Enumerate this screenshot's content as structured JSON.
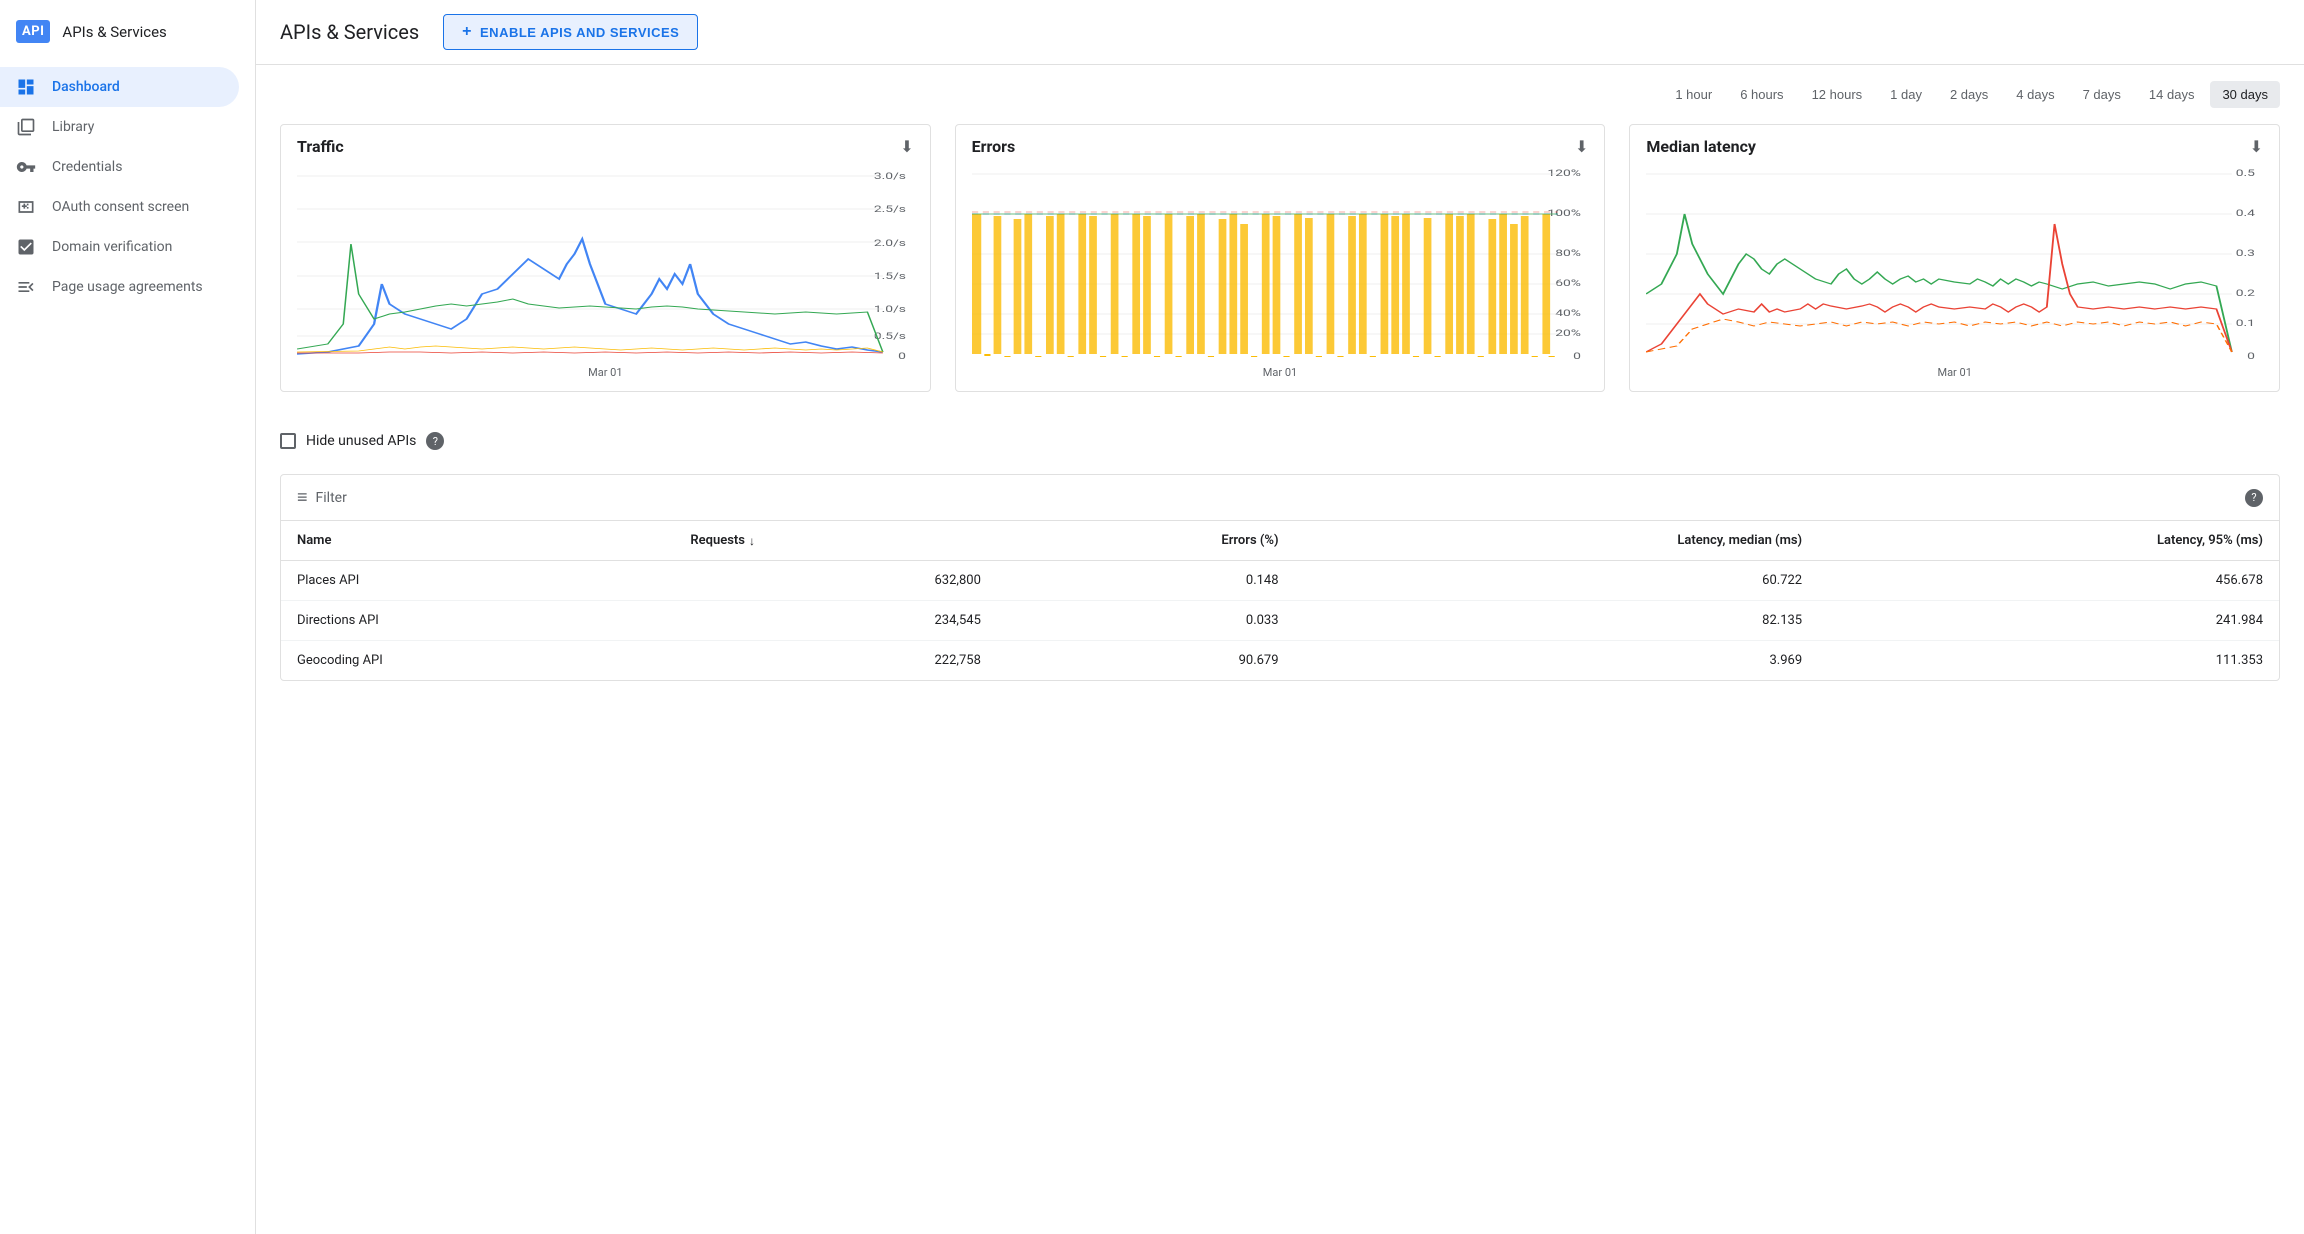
{
  "sidebar": {
    "logo_text": "API",
    "title": "APIs & Services",
    "items": [
      {
        "id": "dashboard",
        "label": "Dashboard",
        "icon": "◈",
        "active": true
      },
      {
        "id": "library",
        "label": "Library",
        "icon": "▦",
        "active": false
      },
      {
        "id": "credentials",
        "label": "Credentials",
        "icon": "⚿",
        "active": false
      },
      {
        "id": "oauth",
        "label": "OAuth consent screen",
        "icon": "⋮⋮",
        "active": false
      },
      {
        "id": "domain",
        "label": "Domain verification",
        "icon": "☑",
        "active": false
      },
      {
        "id": "page-usage",
        "label": "Page usage agreements",
        "icon": "≡☆",
        "active": false
      }
    ]
  },
  "header": {
    "title": "APIs & Services",
    "enable_button_label": "ENABLE APIS AND SERVICES"
  },
  "time_range": {
    "options": [
      "1 hour",
      "6 hours",
      "12 hours",
      "1 day",
      "2 days",
      "4 days",
      "7 days",
      "14 days",
      "30 days"
    ],
    "active": "30 days"
  },
  "charts": {
    "traffic": {
      "title": "Traffic",
      "x_label": "Mar 01"
    },
    "errors": {
      "title": "Errors",
      "x_label": "Mar 01"
    },
    "latency": {
      "title": "Median latency",
      "x_label": "Mar 01"
    }
  },
  "hide_unused": {
    "label": "Hide unused APIs",
    "checked": false
  },
  "table": {
    "filter_placeholder": "Filter",
    "columns": [
      {
        "key": "name",
        "label": "Name"
      },
      {
        "key": "requests",
        "label": "Requests",
        "sortable": true
      },
      {
        "key": "errors",
        "label": "Errors (%)"
      },
      {
        "key": "latency_median",
        "label": "Latency, median (ms)"
      },
      {
        "key": "latency_95",
        "label": "Latency, 95% (ms)"
      }
    ],
    "rows": [
      {
        "name": "Places API",
        "requests": "632,800",
        "errors": "0.148",
        "latency_median": "60.722",
        "latency_95": "456.678"
      },
      {
        "name": "Directions API",
        "requests": "234,545",
        "errors": "0.033",
        "latency_median": "82.135",
        "latency_95": "241.984"
      },
      {
        "name": "Geocoding API",
        "requests": "222,758",
        "errors": "90.679",
        "latency_median": "3.969",
        "latency_95": "111.353"
      }
    ]
  }
}
